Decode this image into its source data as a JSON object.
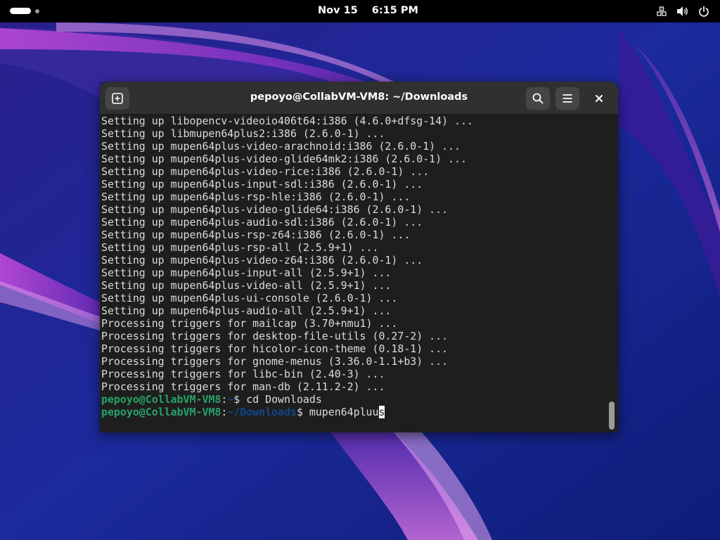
{
  "topbar": {
    "date": "Nov 15",
    "time": "6:15 PM"
  },
  "window": {
    "title": "pepoyo@CollabVM-VM8: ~/Downloads"
  },
  "terminal": {
    "output": [
      "Setting up libopencv-videoio406t64:i386 (4.6.0+dfsg-14) ...",
      "Setting up libmupen64plus2:i386 (2.6.0-1) ...",
      "Setting up mupen64plus-video-arachnoid:i386 (2.6.0-1) ...",
      "Setting up mupen64plus-video-glide64mk2:i386 (2.6.0-1) ...",
      "Setting up mupen64plus-video-rice:i386 (2.6.0-1) ...",
      "Setting up mupen64plus-input-sdl:i386 (2.6.0-1) ...",
      "Setting up mupen64plus-rsp-hle:i386 (2.6.0-1) ...",
      "Setting up mupen64plus-video-glide64:i386 (2.6.0-1) ...",
      "Setting up mupen64plus-audio-sdl:i386 (2.6.0-1) ...",
      "Setting up mupen64plus-rsp-z64:i386 (2.6.0-1) ...",
      "Setting up mupen64plus-rsp-all (2.5.9+1) ...",
      "Setting up mupen64plus-video-z64:i386 (2.6.0-1) ...",
      "Setting up mupen64plus-input-all (2.5.9+1) ...",
      "Setting up mupen64plus-video-all (2.5.9+1) ...",
      "Setting up mupen64plus-ui-console (2.6.0-1) ...",
      "Setting up mupen64plus-audio-all (2.5.9+1) ...",
      "Processing triggers for mailcap (3.70+nmu1) ...",
      "Processing triggers for desktop-file-utils (0.27-2) ...",
      "Processing triggers for hicolor-icon-theme (0.18-1) ...",
      "Processing triggers for gnome-menus (3.36.0-1.1+b3) ...",
      "Processing triggers for libc-bin (2.40-3) ...",
      "Processing triggers for man-db (2.11.2-2) ..."
    ],
    "prompt1": {
      "user": "pepoyo@CollabVM-VM8",
      "sep": ":",
      "path": "~",
      "symbol": "$ ",
      "command": "cd Downloads"
    },
    "prompt2": {
      "user": "pepoyo@CollabVM-VM8",
      "sep": ":",
      "path": "~/Downloads",
      "symbol": "$ ",
      "command": "mupen64pluu",
      "cursor_char": "s"
    }
  },
  "icons": {
    "new_tab": "new-tab-icon",
    "search": "search-icon",
    "menu": "hamburger-menu-icon",
    "close": "close-icon",
    "network": "network-icon",
    "volume": "volume-icon",
    "power": "power-icon"
  },
  "colors": {
    "prompt_user": "#26a269",
    "prompt_path": "#12488b",
    "terminal_bg": "#1e1e1e",
    "headerbar_bg": "#303030"
  }
}
